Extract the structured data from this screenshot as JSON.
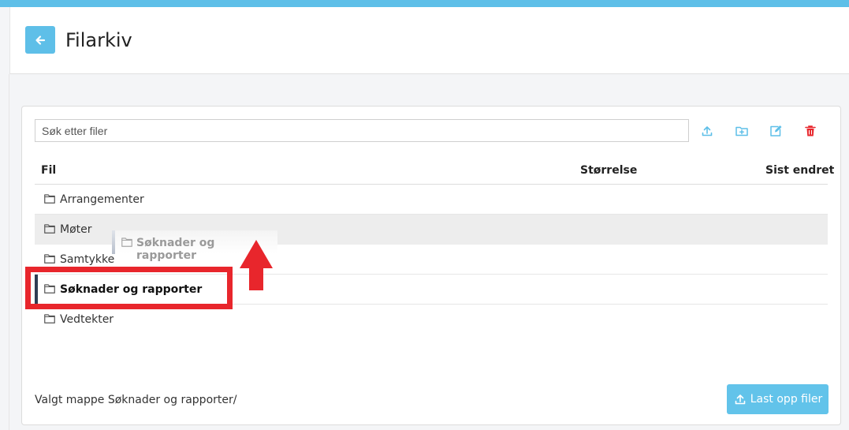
{
  "header": {
    "title": "Filarkiv",
    "back_icon": "arrow-left-icon"
  },
  "search": {
    "placeholder": "Søk etter filer",
    "value": ""
  },
  "toolbar": {
    "icons": [
      "upload-icon",
      "new-folder-icon",
      "edit-icon",
      "trash-icon"
    ],
    "accent_color": "#5ebfe8",
    "danger_color": "#e8262c"
  },
  "table": {
    "columns": {
      "file": "Fil",
      "size": "Størrelse",
      "modified": "Sist endret"
    },
    "rows": [
      {
        "name": "Arrangementer",
        "state": "normal"
      },
      {
        "name": "Møter",
        "state": "hover"
      },
      {
        "name": "Samtykke",
        "state": "normal"
      },
      {
        "name": "Søknader og rapporter",
        "state": "selected"
      },
      {
        "name": "Vedtekter",
        "state": "normal"
      }
    ]
  },
  "drag_ghost": {
    "label": "Søknader og rapporter"
  },
  "footer": {
    "selected_folder_text": "Valgt mappe Søknader og rapporter/",
    "upload_button_label": "Last opp filer"
  },
  "annotations": {
    "highlight_color": "#e8262c",
    "arrow": "red-up-arrow-icon"
  }
}
